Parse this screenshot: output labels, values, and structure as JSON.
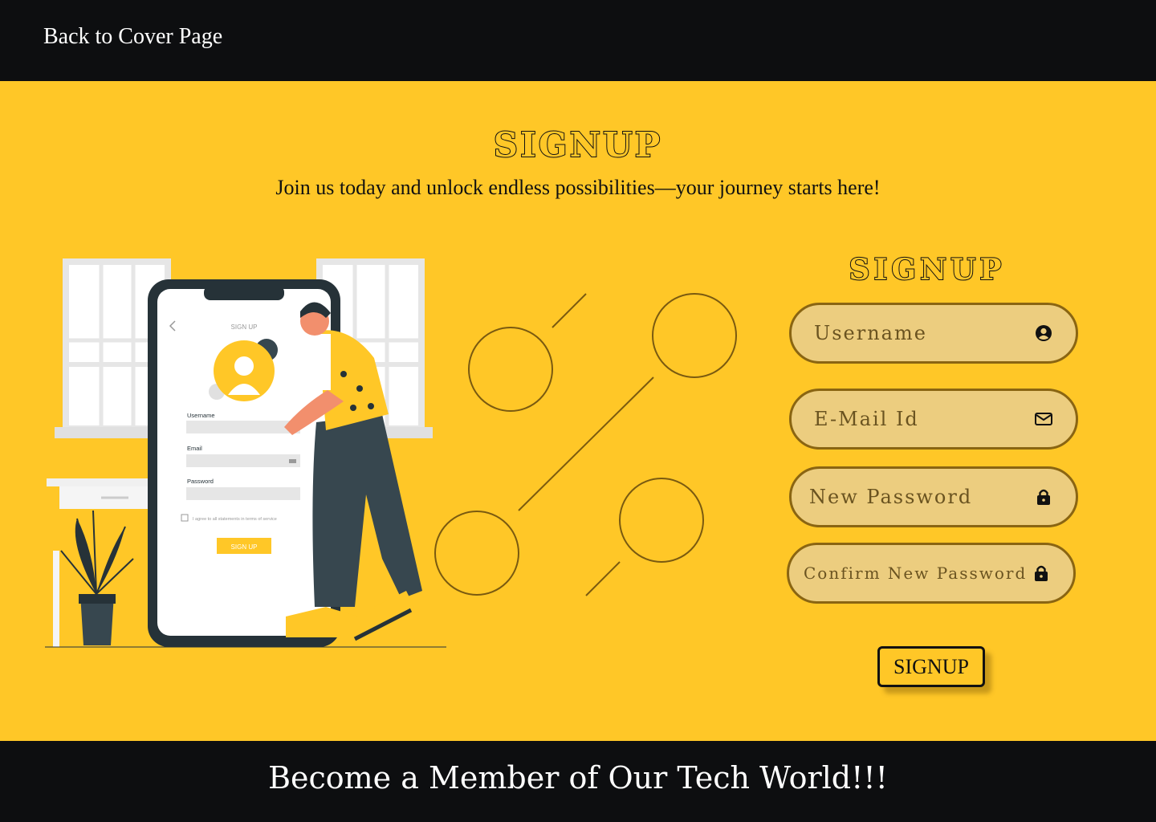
{
  "nav": {
    "back_link": "Back to Cover Page"
  },
  "hero": {
    "title": "SIGNUP",
    "subtitle": "Join us today and unlock endless possibilities—your journey starts here!"
  },
  "illustration": {
    "phone_title": "SIGN UP",
    "username_label": "Username",
    "email_label": "Email",
    "password_label": "Password",
    "terms_text": "I agree to all statements in terms of service",
    "button": "SIGN UP"
  },
  "form": {
    "title": "SIGNUP",
    "username": {
      "placeholder": "Username",
      "icon": "user-circle-icon"
    },
    "email": {
      "placeholder": "E-Mail Id",
      "icon": "mail-icon"
    },
    "new_password": {
      "placeholder": "New Password",
      "icon": "lock-icon"
    },
    "confirm_password": {
      "placeholder": "Confirm New Password",
      "icon": "lock-icon"
    },
    "submit": "SIGNUP"
  },
  "footer": {
    "text": "Become a Member of Our Tech World!!!"
  },
  "colors": {
    "background": "#ffc727",
    "bars": "#0d0e10",
    "field_fill": "#eccd7f",
    "field_border": "#8a6512"
  }
}
